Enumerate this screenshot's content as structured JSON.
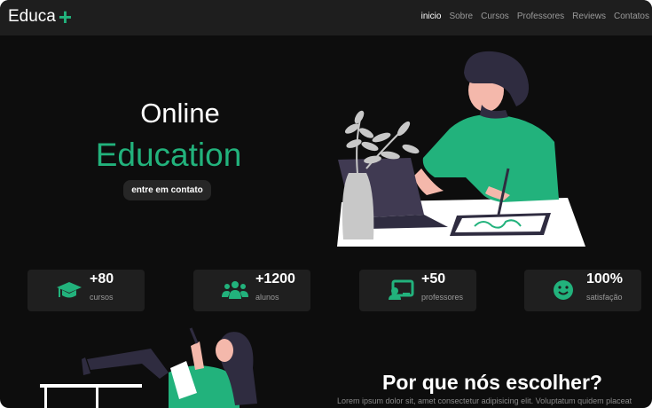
{
  "brand": {
    "name": "Educa",
    "plus": "+"
  },
  "nav": {
    "items": [
      {
        "label": "inicio",
        "active": true
      },
      {
        "label": "Sobre"
      },
      {
        "label": "Cursos"
      },
      {
        "label": "Professores"
      },
      {
        "label": "Reviews"
      },
      {
        "label": "Contatos"
      }
    ]
  },
  "hero": {
    "title_line1": "Online",
    "title_line2": "Education",
    "cta": "entre em contato"
  },
  "stats": [
    {
      "value": "+80",
      "label": "cursos",
      "icon": "graduation-cap-icon"
    },
    {
      "value": "+1200",
      "label": "alunos",
      "icon": "users-icon"
    },
    {
      "value": "+50",
      "label": "professores",
      "icon": "teacher-icon"
    },
    {
      "value": "100%",
      "label": "satisfação",
      "icon": "smile-icon"
    }
  ],
  "why": {
    "heading": "Por que nós escolher?",
    "text": "Lorem ipsum dolor sit, amet consectetur adipisicing elit. Voluptatum quidem placeat"
  },
  "colors": {
    "accent": "#22b27c",
    "background": "#0d0d0d",
    "nav": "#1e1e1e",
    "card": "#1f1f1f"
  }
}
